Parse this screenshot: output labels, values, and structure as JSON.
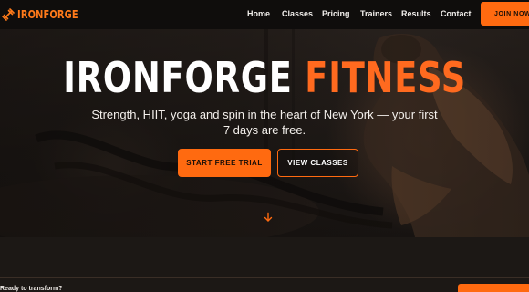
{
  "nav": {
    "brand": "IRONFORGE",
    "links": [
      {
        "id": "home",
        "label": "Home"
      },
      {
        "id": "classes",
        "label": "Classes"
      },
      {
        "id": "pricing",
        "label": "Pricing"
      },
      {
        "id": "trainers",
        "label": "Trainers"
      },
      {
        "id": "results",
        "label": "Results"
      },
      {
        "id": "contact",
        "label": "Contact"
      }
    ],
    "cta_label": "JOIN NOW"
  },
  "hero": {
    "title_part1": "IRONFORGE",
    "title_part2": "FITNESS",
    "subtitle": "Strength, HIIT, yoga and spin in the heart of New York — your first 7 days are free.",
    "primary_cta": "START FREE TRIAL",
    "secondary_cta": "VIEW CLASSES"
  },
  "cta_strip": {
    "text": "Ready to transform?"
  },
  "colors": {
    "accent": "#ff6a10",
    "nav_background": "#0f0d0c",
    "page_background": "#1c1815"
  },
  "icons": {
    "logo": "dumbbell-logo-icon",
    "scroll": "arrow-down-icon"
  }
}
